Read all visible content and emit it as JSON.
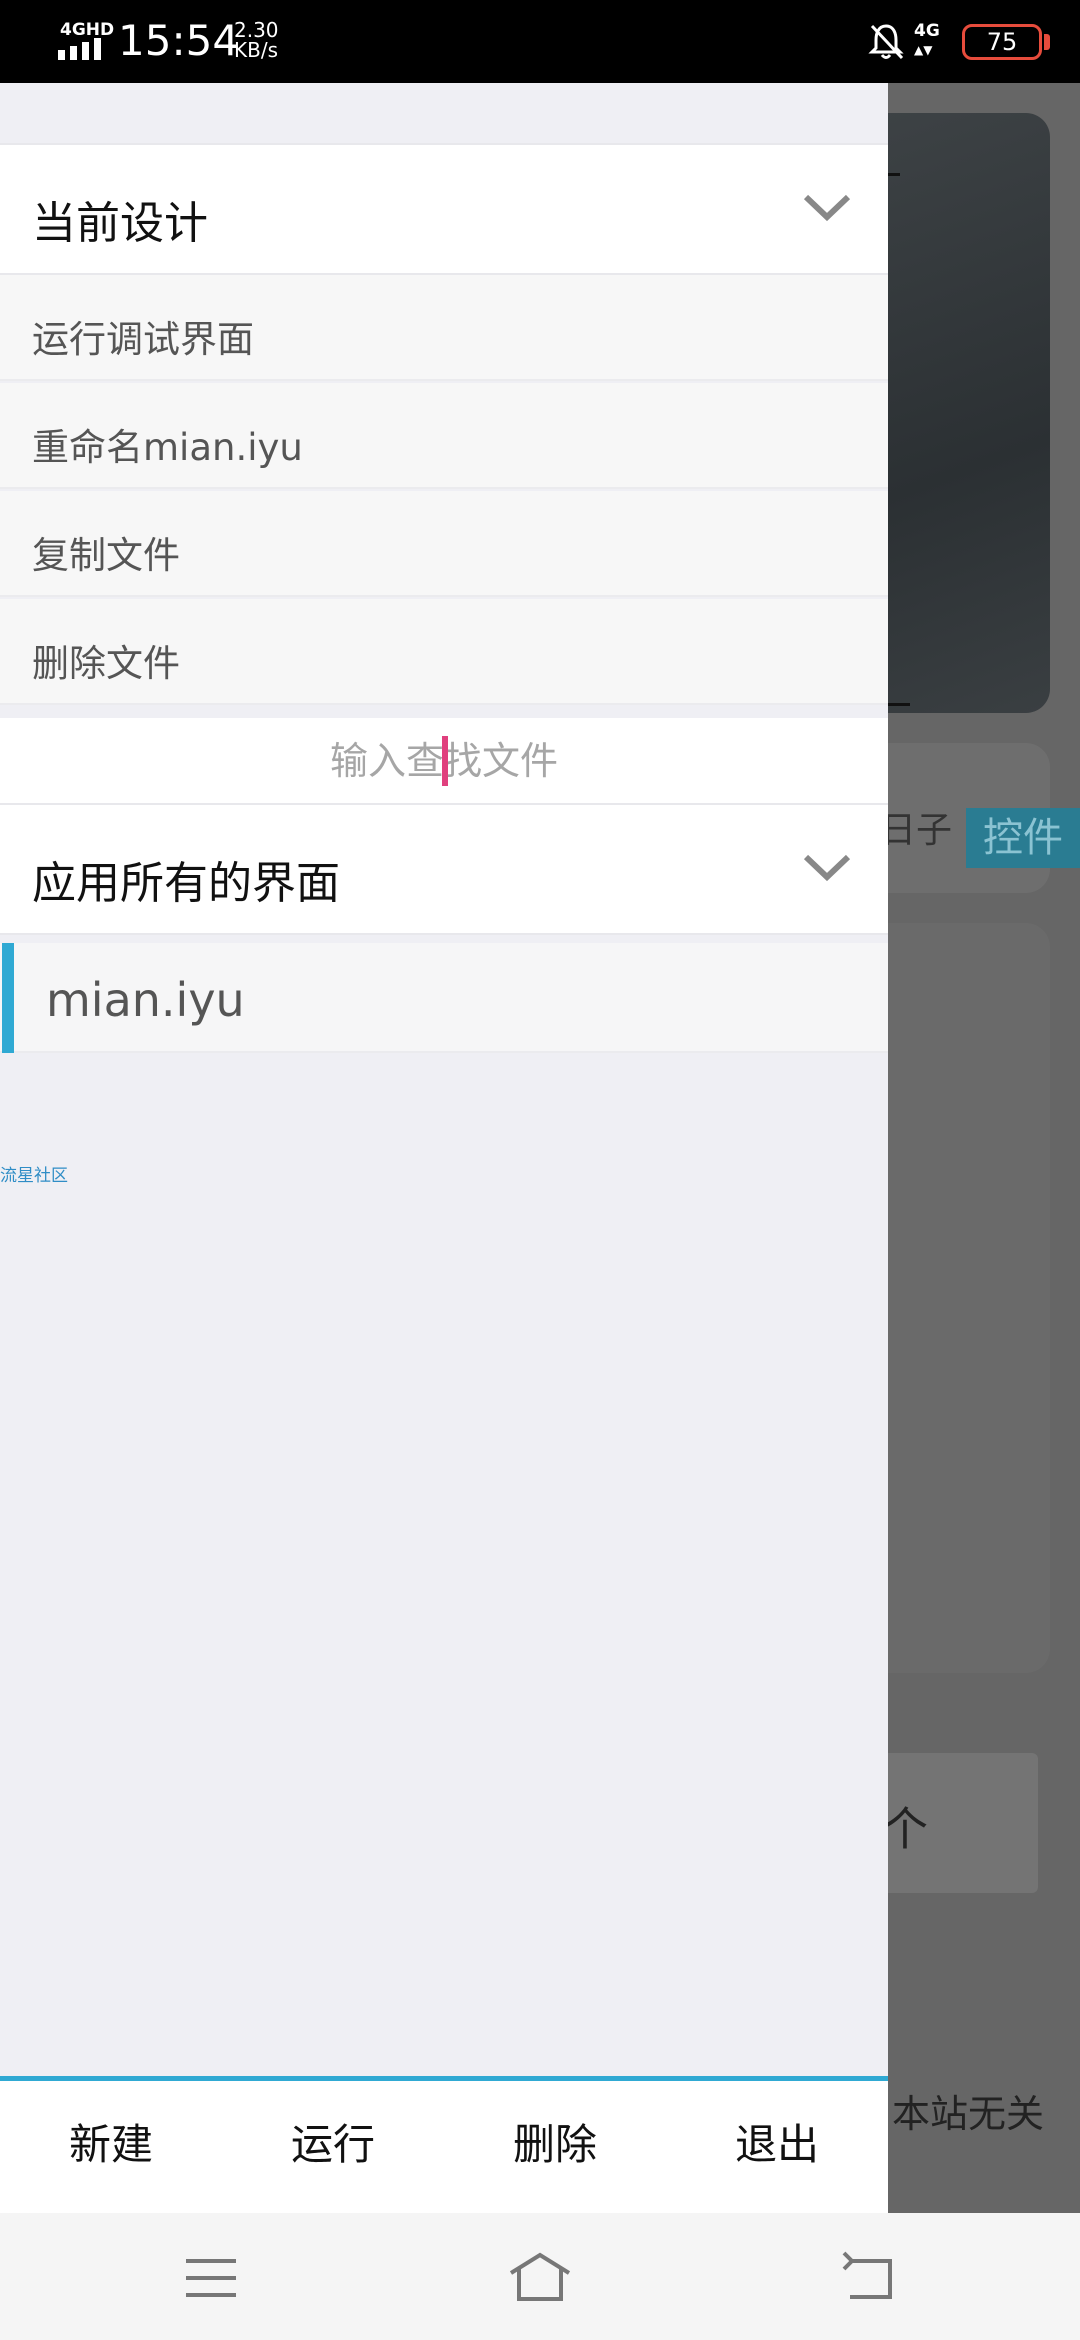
{
  "status_bar": {
    "network_type": "4GHD",
    "time": "15:54",
    "speed_value": "2.30",
    "speed_unit": "KB/s",
    "mobile_data": "4G",
    "battery": "75",
    "icons": [
      "signal-icon",
      "bell-muted-icon",
      "battery-icon"
    ]
  },
  "drawer": {
    "current_design": {
      "title": "当前设计",
      "items": [
        {
          "label": "运行调试界面"
        },
        {
          "label": "重命名mian.iyu"
        },
        {
          "label": "复制文件"
        },
        {
          "label": "删除文件"
        }
      ]
    },
    "search": {
      "placeholder": "输入查找文件"
    },
    "all_screens": {
      "title": "应用所有的界面",
      "files": [
        {
          "label": "mian.iyu",
          "selected": true
        }
      ]
    },
    "watermark": "流星社区",
    "bottom_bar": {
      "tabs": [
        {
          "label": "新建"
        },
        {
          "label": "运行"
        },
        {
          "label": "删除"
        },
        {
          "label": "退出"
        }
      ]
    }
  },
  "background": {
    "card_text": "日子",
    "control_label": "控件",
    "button_text": "个",
    "footer_text": "本站无关"
  },
  "colors": {
    "accent": "#2fa9d3",
    "cursor": "#e0407e",
    "drawer_bg": "#efeff4"
  },
  "nav_bar": {
    "icons": [
      "menu-icon",
      "home-icon",
      "back-icon"
    ]
  }
}
